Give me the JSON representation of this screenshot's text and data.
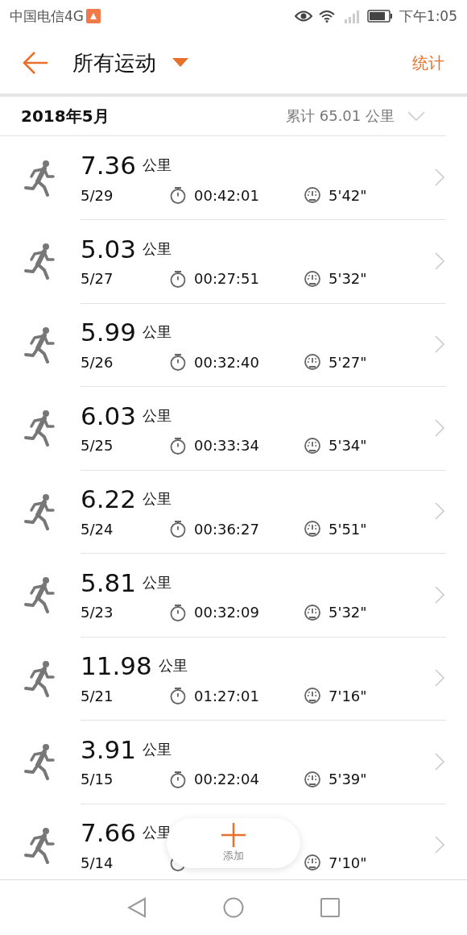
{
  "status_bar": {
    "carrier": "中国电信4G",
    "time": "下午1:05"
  },
  "header": {
    "title": "所有运动",
    "action": "统计"
  },
  "month": {
    "label": "2018年5月",
    "total": "累计 65.01 公里",
    "expanded": false
  },
  "activities": [
    {
      "distance": "7.36",
      "unit": "公里",
      "date": "5/29",
      "duration": "00:42:01",
      "pace": "5'42\""
    },
    {
      "distance": "5.03",
      "unit": "公里",
      "date": "5/27",
      "duration": "00:27:51",
      "pace": "5'32\""
    },
    {
      "distance": "5.99",
      "unit": "公里",
      "date": "5/26",
      "duration": "00:32:40",
      "pace": "5'27\""
    },
    {
      "distance": "6.03",
      "unit": "公里",
      "date": "5/25",
      "duration": "00:33:34",
      "pace": "5'34\""
    },
    {
      "distance": "6.22",
      "unit": "公里",
      "date": "5/24",
      "duration": "00:36:27",
      "pace": "5'51\""
    },
    {
      "distance": "5.81",
      "unit": "公里",
      "date": "5/23",
      "duration": "00:32:09",
      "pace": "5'32\""
    },
    {
      "distance": "11.98",
      "unit": "公里",
      "date": "5/21",
      "duration": "01:27:01",
      "pace": "7'16\""
    },
    {
      "distance": "3.91",
      "unit": "公里",
      "date": "5/15",
      "duration": "00:22:04",
      "pace": "5'39\""
    },
    {
      "distance": "7.66",
      "unit": "公里",
      "date": "5/14",
      "pace": "7'10\""
    }
  ],
  "add_button": {
    "label": "添加"
  }
}
